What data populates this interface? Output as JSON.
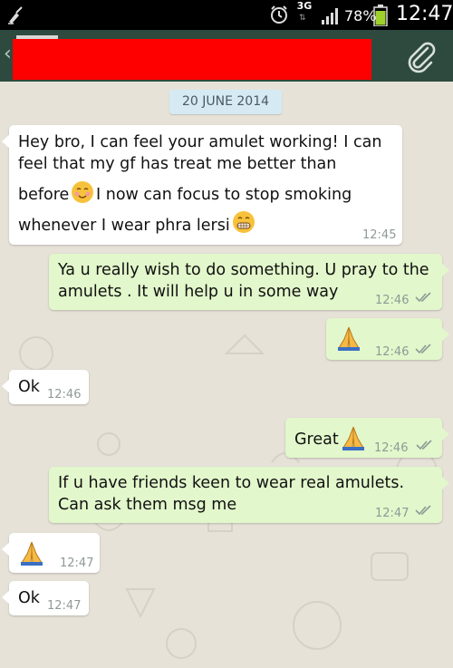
{
  "status_bar": {
    "network": "3G",
    "battery_percent": "78%",
    "time": "12:47"
  },
  "action_bar": {
    "contact_name_redacted": true,
    "icons": [
      "back-icon",
      "avatar",
      "attach-icon"
    ]
  },
  "chat": {
    "date_chip": "20 JUNE 2014",
    "messages": [
      {
        "direction": "in",
        "lines": [
          "Hey bro, I can feel your amulet working! I can",
          "feel that my gf has treat me better than",
          "before",
          " I now can focus to stop smoking",
          "whenever I wear phra lersi"
        ],
        "emojis": [
          "smiling-blush-emoji",
          "grinning-emoji"
        ],
        "time": "12:45"
      },
      {
        "direction": "out",
        "lines": [
          "Ya u really wish to do something. U pray to the",
          "amulets . It will help u in some way"
        ],
        "time": "12:46",
        "status": "read"
      },
      {
        "direction": "out",
        "emojis": [
          "praying-hands-emoji"
        ],
        "time": "12:46",
        "status": "read"
      },
      {
        "direction": "in",
        "text": "Ok",
        "time": "12:46"
      },
      {
        "direction": "out",
        "text": "Great",
        "emojis": [
          "praying-hands-emoji"
        ],
        "time": "12:46",
        "status": "read"
      },
      {
        "direction": "out",
        "lines": [
          "If u have friends keen to wear real amulets.",
          "Can ask them msg me"
        ],
        "time": "12:47",
        "status": "read"
      },
      {
        "direction": "in",
        "emojis": [
          "praying-hands-emoji"
        ],
        "time": "12:47"
      },
      {
        "direction": "in",
        "text": "Ok",
        "time": "12:47"
      }
    ]
  },
  "colors": {
    "status_bar": "#000000",
    "action_bar": "#2e4a3e",
    "chat_bg": "#e6e2d8",
    "incoming_bubble": "#ffffff",
    "outgoing_bubble": "#e2f7cb",
    "date_chip": "#d5eaf3",
    "redaction": "#ff0000"
  }
}
